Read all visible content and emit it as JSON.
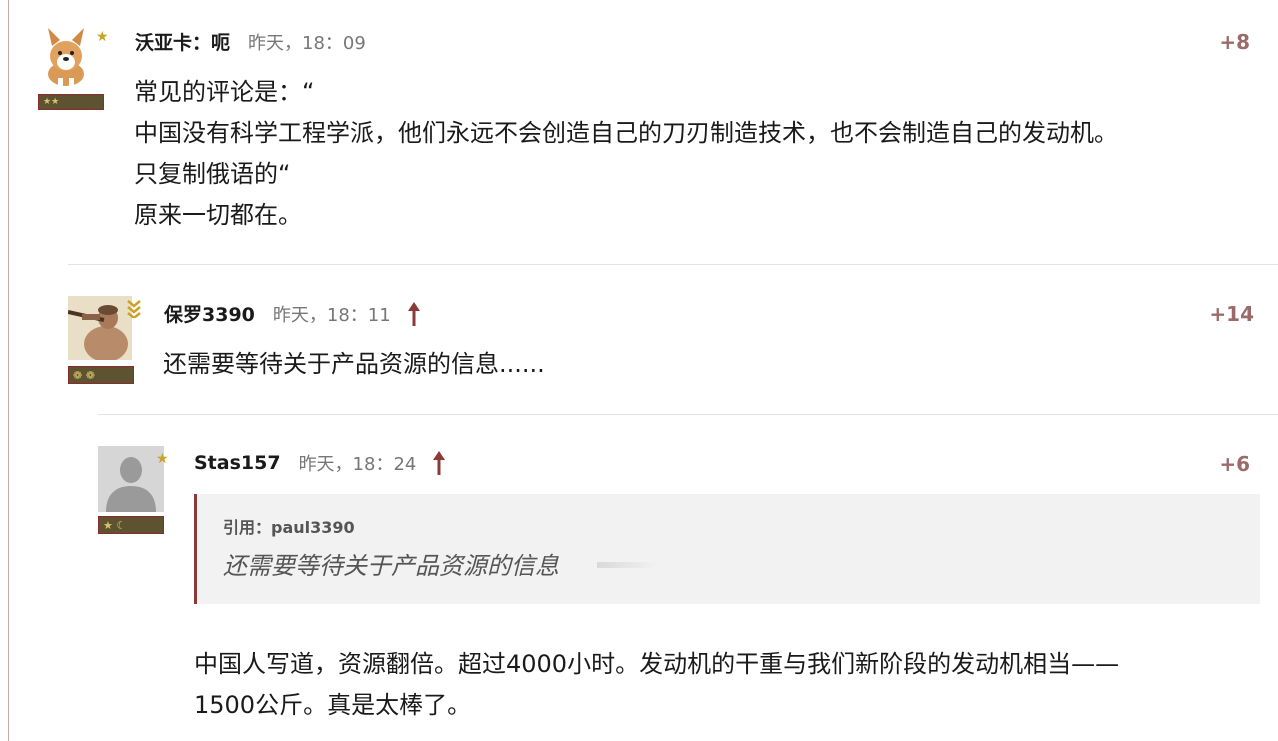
{
  "comments": [
    {
      "author": "沃亚卡：呃",
      "time": "昨天，18：09",
      "score": "+8",
      "lines": [
        "常见的评论是：“",
        "中国没有科学工程学派，他们永远不会创造自己的刀刃制造技术，也不会制造自己的发动机。",
        "只复制俄语的“",
        "原来一切都在。"
      ]
    },
    {
      "author": "保罗3390",
      "time": "昨天，18：11",
      "score": "+14",
      "lines": [
        "还需要等待关于产品资源的信息......"
      ]
    },
    {
      "author": "Stas157",
      "time": "昨天，18：24",
      "score": "+6",
      "quote": {
        "header": "引用：paul3390",
        "text": "还需要等待关于产品资源的信息"
      },
      "lines": [
        "中国人写道，资源翻倍。超过4000小时。发动机的干重与我们新阶段的发动机相当——",
        "1500公斤。真是太棒了。"
      ]
    }
  ],
  "colors": {
    "score": "#9b6b6b",
    "arrow": "#8b3a3a",
    "badge_bg": "#5d5331",
    "badge_border": "#8b2b2b",
    "star": "#c9a227"
  },
  "icons": [
    "corgi-avatar",
    "hunter-avatar",
    "default-user-avatar",
    "rank-star-icon",
    "rank-chevron-icon",
    "upvote-arrow-icon"
  ]
}
